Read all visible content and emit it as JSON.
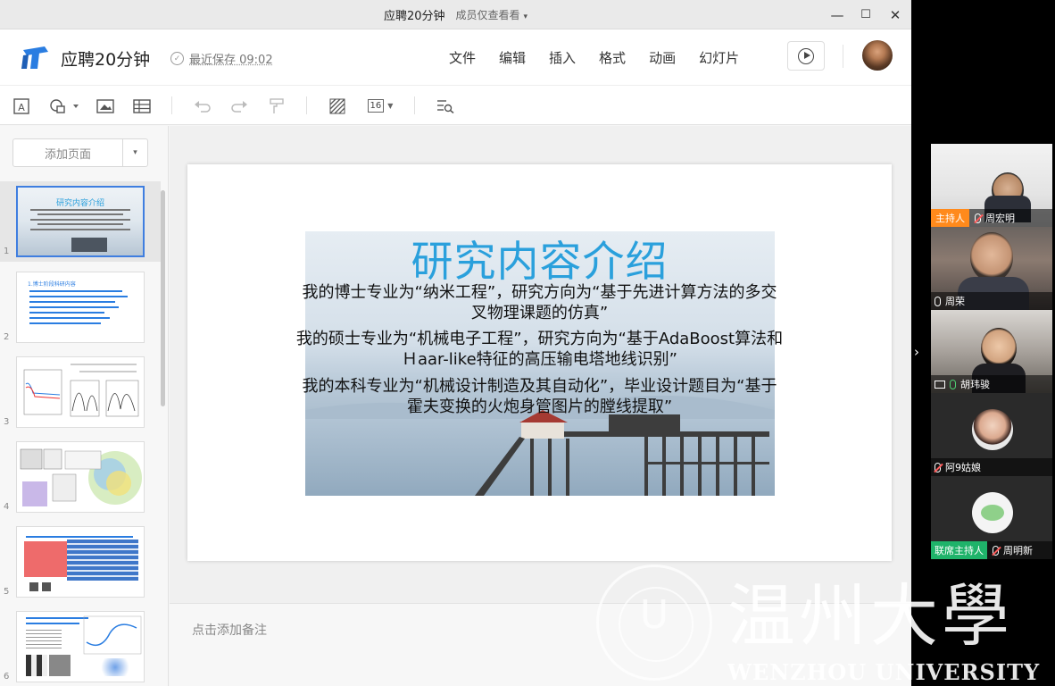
{
  "window": {
    "title": "应聘20分钟",
    "subtitle": "成员仅查看看",
    "subtitle_caret": "▾",
    "min_icon": "—",
    "max_icon": "☐",
    "close_icon": "✕"
  },
  "header": {
    "doc_title": "应聘20分钟",
    "save_status": "最近保存 09:02",
    "check_glyph": "✓",
    "menu": [
      "文件",
      "编辑",
      "插入",
      "格式",
      "动画",
      "幻灯片"
    ],
    "accent_color": "#2a7de1"
  },
  "toolbar": {
    "font_size": "16",
    "icons": [
      "text-box-icon",
      "shape-icon",
      "image-icon",
      "table-icon",
      "undo-icon",
      "redo-icon",
      "format-painter-icon",
      "fill-pattern-icon",
      "font-size-icon",
      "find-replace-icon"
    ]
  },
  "sidebar": {
    "add_page_label": "添加页面",
    "dropdown_caret": "▾",
    "thumbnails": [
      {
        "num": "1",
        "title": "研究内容介绍",
        "selected": true
      },
      {
        "num": "2",
        "title": "1.博士阶段科研内容",
        "selected": false
      },
      {
        "num": "3",
        "title": "",
        "selected": false
      },
      {
        "num": "4",
        "title": "",
        "selected": false
      },
      {
        "num": "5",
        "title": "",
        "selected": false
      },
      {
        "num": "6",
        "title": "",
        "selected": false
      }
    ]
  },
  "slide": {
    "title": "研究内容介绍",
    "paragraphs": [
      "我的博士专业为“纳米工程”，研究方向为“基于先进计算方法的多交",
      "叉物理课题的仿真”",
      "我的硕士专业为“机械电子工程”，研究方向为“基于AdaBoost算法和",
      "Ｈaar-like特征的高压输电塔地线识别”",
      "我的本科专业为“机械设计制造及其自动化”，毕业设计题目为“基于",
      "霍夫变换的火炮身管图片的膛线提取”"
    ],
    "title_color": "#2aa0dc"
  },
  "notes": {
    "placeholder": "点击添加备注"
  },
  "participants": [
    {
      "name": "周宏明",
      "role": "主持人",
      "muted": true
    },
    {
      "name": "周荣",
      "role": "",
      "muted": false
    },
    {
      "name": "胡玮骏",
      "role": "",
      "muted": false,
      "sharing": true
    },
    {
      "name": "阿9姑娘",
      "role": "",
      "muted": true
    },
    {
      "name": "周明新",
      "role": "联席主持人",
      "muted": true
    }
  ],
  "collapse_icon": "›",
  "watermark": {
    "cn": "温州大學",
    "en": "WENZHOU UNIVERSITY"
  }
}
